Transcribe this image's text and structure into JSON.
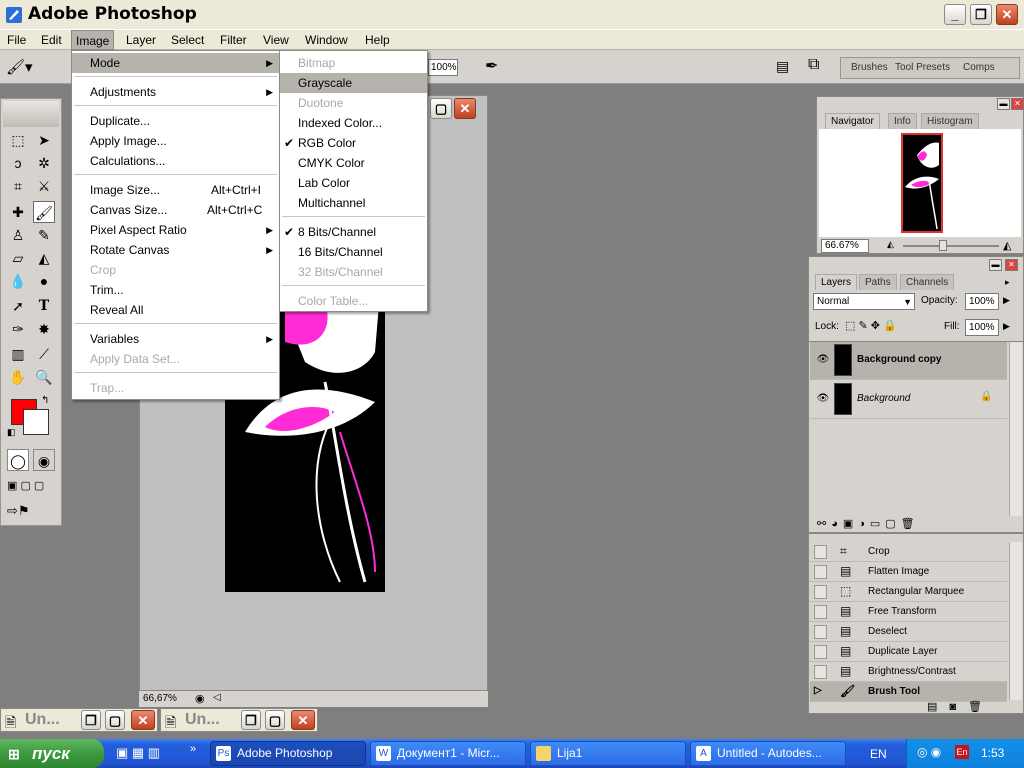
{
  "window": {
    "title": "Adobe Photoshop"
  },
  "menubar": [
    "File",
    "Edit",
    "Image",
    "Layer",
    "Select",
    "Filter",
    "View",
    "Window",
    "Help"
  ],
  "options": {
    "zoom": "100%"
  },
  "palette_well": {
    "tabs": [
      "Brushes",
      "Tool Presets",
      "Comps"
    ]
  },
  "image_menu": {
    "items": [
      {
        "label": "Mode",
        "submenu": true,
        "highlight": true
      },
      {
        "label": "Adjustments",
        "submenu": true
      },
      {
        "label": "Duplicate..."
      },
      {
        "label": "Apply Image..."
      },
      {
        "label": "Calculations..."
      },
      {
        "label": "Image Size...",
        "shortcut": "Alt+Ctrl+I"
      },
      {
        "label": "Canvas Size...",
        "shortcut": "Alt+Ctrl+C"
      },
      {
        "label": "Pixel Aspect Ratio",
        "submenu": true
      },
      {
        "label": "Rotate Canvas",
        "submenu": true
      },
      {
        "label": "Crop",
        "disabled": true
      },
      {
        "label": "Trim..."
      },
      {
        "label": "Reveal All"
      },
      {
        "label": "Variables",
        "submenu": true
      },
      {
        "label": "Apply Data Set...",
        "disabled": true
      },
      {
        "label": "Trap...",
        "disabled": true
      }
    ]
  },
  "mode_menu": {
    "items": [
      {
        "label": "Bitmap",
        "disabled": true
      },
      {
        "label": "Grayscale",
        "highlight": true
      },
      {
        "label": "Duotone",
        "disabled": true
      },
      {
        "label": "Indexed Color..."
      },
      {
        "label": "RGB Color",
        "checked": true
      },
      {
        "label": "CMYK Color"
      },
      {
        "label": "Lab Color"
      },
      {
        "label": "Multichannel"
      },
      {
        "label": "8 Bits/Channel",
        "checked": true
      },
      {
        "label": "16 Bits/Channel"
      },
      {
        "label": "32 Bits/Channel",
        "disabled": true
      },
      {
        "label": "Color Table...",
        "disabled": true
      }
    ]
  },
  "document": {
    "zoom": "66,67%"
  },
  "navigator": {
    "tabs": [
      "Navigator",
      "Info",
      "Histogram"
    ],
    "zoom": "66.67%"
  },
  "layers": {
    "tabs": [
      "Layers",
      "Paths",
      "Channels"
    ],
    "blend_mode": "Normal",
    "opacity_label": "Opacity:",
    "opacity": "100%",
    "lock_label": "Lock:",
    "fill_label": "Fill:",
    "fill": "100%",
    "rows": [
      {
        "name": "Background copy",
        "selected": true
      },
      {
        "name": "Background",
        "locked": true
      }
    ]
  },
  "history": {
    "items": [
      "Crop",
      "Flatten Image",
      "Rectangular Marquee",
      "Free Transform",
      "Deselect",
      "Duplicate Layer",
      "Brightness/Contrast",
      "Brush Tool"
    ]
  },
  "minimized": [
    {
      "title": "Un..."
    },
    {
      "title": "Un..."
    }
  ],
  "taskbar": {
    "start": "пуск",
    "buttons": [
      "Adobe Photoshop",
      "Документ1 - Micr...",
      "Lija1",
      "Untitled - Autodes..."
    ],
    "lang": "EN",
    "tray_lang": "En",
    "clock": "1:53"
  },
  "colors": {
    "foreground": "#ff0000",
    "background": "#ffffff",
    "magenta": "#ff2bd6"
  }
}
